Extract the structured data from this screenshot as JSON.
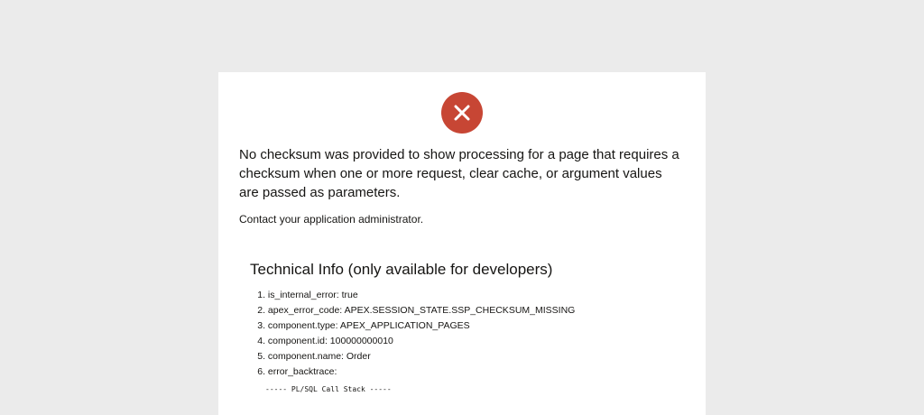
{
  "error": {
    "icon": "close-icon",
    "icon_color": "#c74634",
    "message": "No checksum was provided to show processing for a page that requires a checksum when one or more request, clear cache, or argument values are passed as parameters.",
    "contact": "Contact your application administrator."
  },
  "technical_info": {
    "title": "Technical Info (only available for developers)",
    "items": [
      {
        "num": "1.",
        "text": "is_internal_error: true"
      },
      {
        "num": "2.",
        "text": "apex_error_code: APEX.SESSION_STATE.SSP_CHECKSUM_MISSING"
      },
      {
        "num": "3.",
        "text": "component.type: APEX_APPLICATION_PAGES"
      },
      {
        "num": "4.",
        "text": "component.id: 100000000010"
      },
      {
        "num": "5.",
        "text": "component.name: Order"
      },
      {
        "num": "6.",
        "text": "error_backtrace:"
      }
    ],
    "backtrace": "----- PL/SQL Call Stack -----"
  },
  "colors": {
    "page_background": "#ebebeb",
    "card_background": "#ffffff",
    "text": "#161513"
  }
}
